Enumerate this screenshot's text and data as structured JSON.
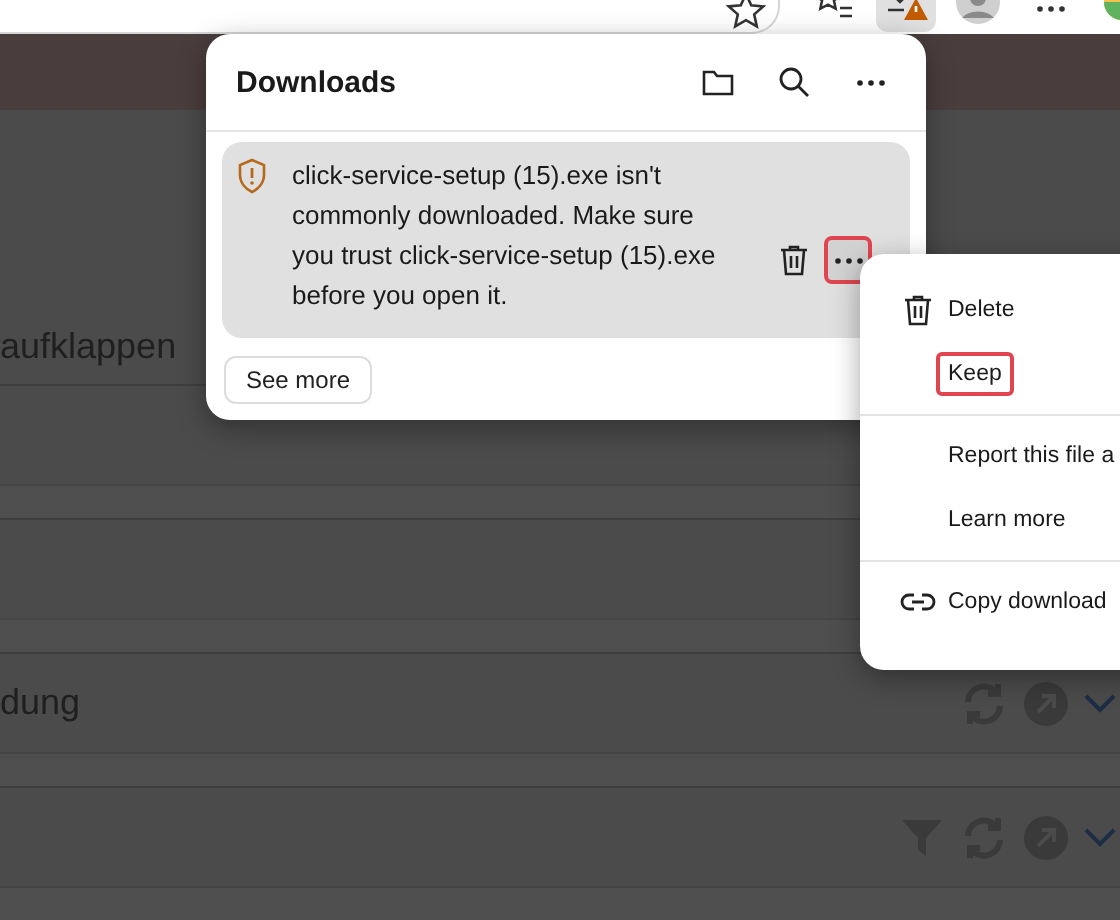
{
  "toolbar": {
    "downloads_active": true
  },
  "page_rows": [
    {
      "kind": "label",
      "label": "aufklappen"
    },
    {
      "kind": "blank"
    },
    {
      "kind": "blank"
    },
    {
      "kind": "label_actions",
      "label": "dung"
    },
    {
      "kind": "filter_actions"
    },
    {
      "kind": "blank"
    }
  ],
  "downloads_panel": {
    "title": "Downloads",
    "item": {
      "message": "click-service-setup (15).exe isn't commonly downloaded. Make sure you trust click-service-setup (15).exe before you open it.",
      "actions": [
        {
          "kind": "delete",
          "highlighted": false
        },
        {
          "kind": "more",
          "highlighted": true
        }
      ]
    },
    "see_more": "See more"
  },
  "context_menu": {
    "groups": [
      [
        {
          "label": "Delete",
          "highlighted": false
        },
        {
          "label": "Keep",
          "highlighted": true
        }
      ],
      [
        {
          "label": "Report this file a",
          "highlighted": false
        },
        {
          "label": "Learn more",
          "highlighted": false
        }
      ],
      [
        {
          "label": "Copy download",
          "highlighted": false
        }
      ]
    ]
  }
}
